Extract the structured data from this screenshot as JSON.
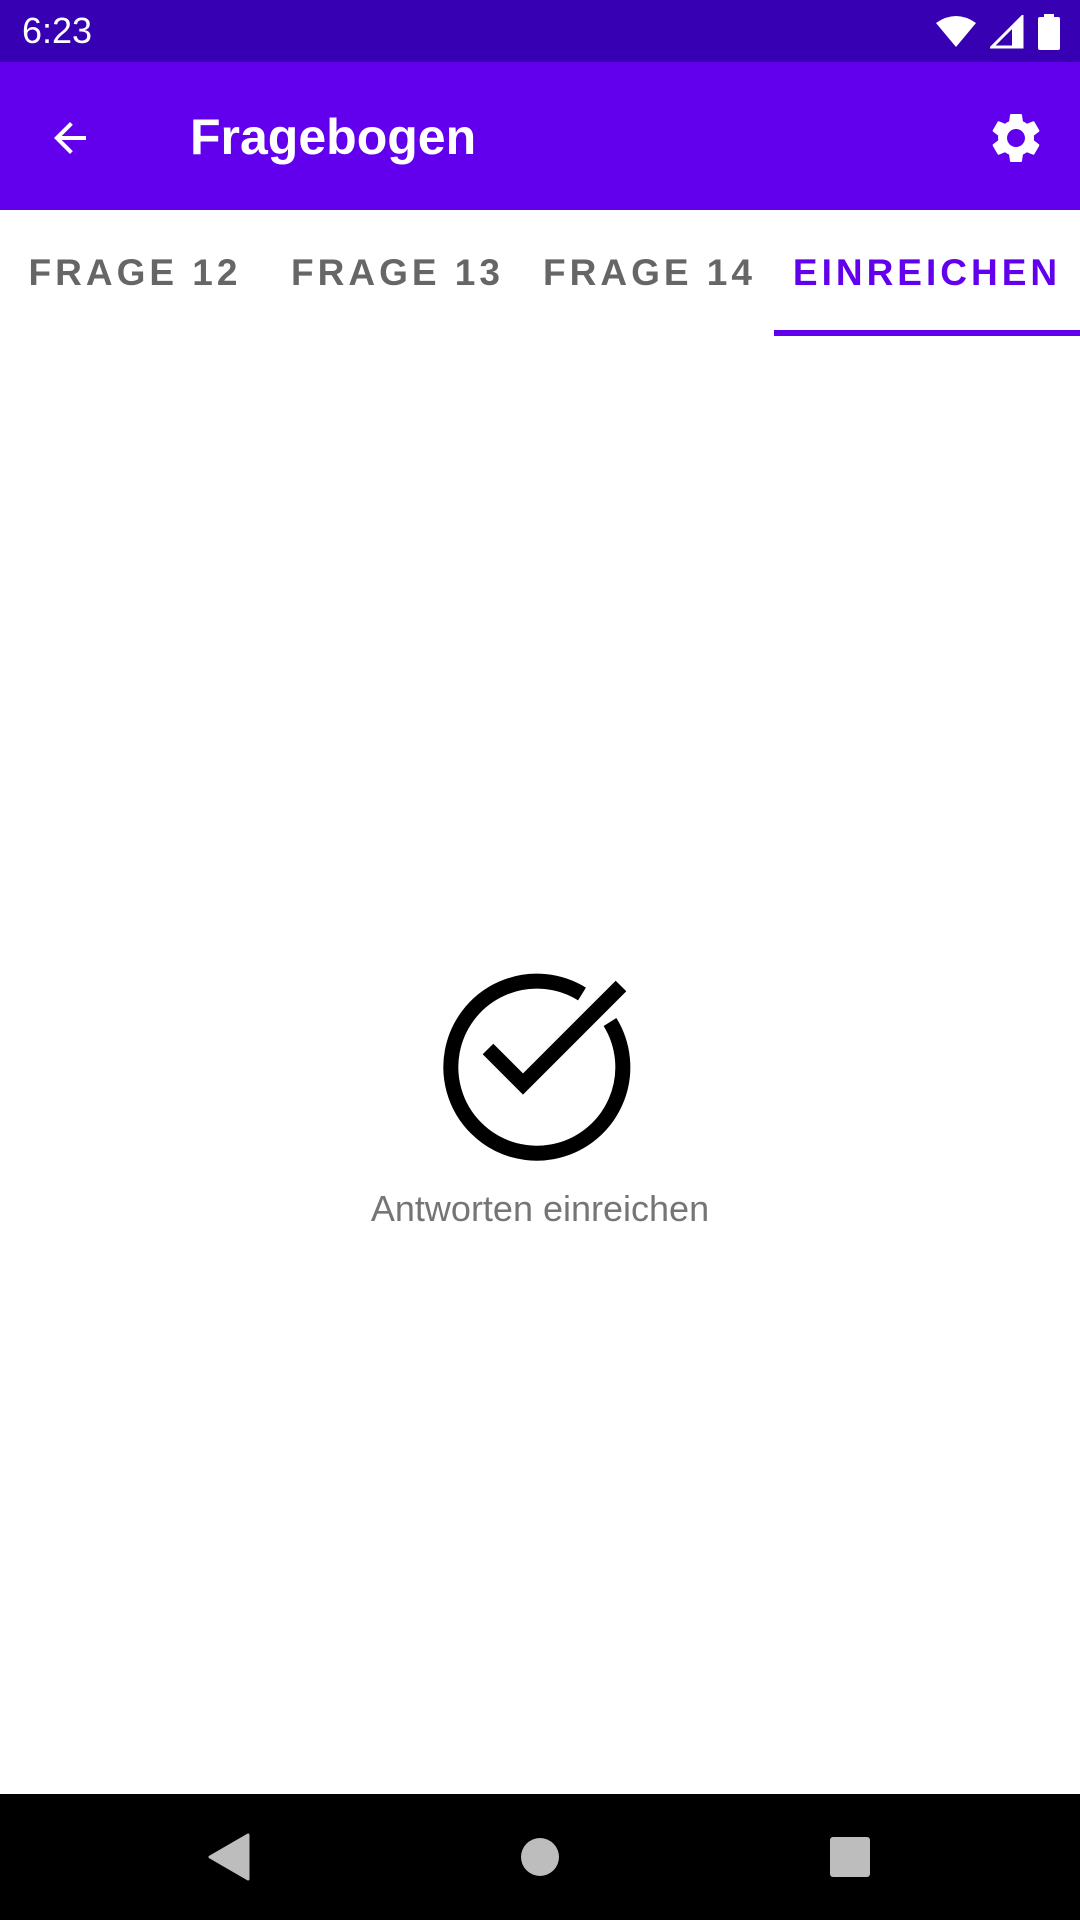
{
  "status_bar": {
    "time": "6:23",
    "icons": [
      "wifi-icon",
      "cellular-signal-icon",
      "battery-icon"
    ]
  },
  "app_bar": {
    "title": "Fragebogen",
    "back_icon": "arrow-back-icon",
    "settings_icon": "gear-icon"
  },
  "tabs": [
    {
      "label": "FRAGE 12",
      "selected": false
    },
    {
      "label": "FRAGE 13",
      "selected": false
    },
    {
      "label": "FRAGE 14",
      "selected": false
    },
    {
      "label": "EINREICHEN",
      "selected": true
    }
  ],
  "main": {
    "submit_icon": "check-circle-icon",
    "submit_label": "Antworten einreichen"
  },
  "nav_bar": {
    "icons": [
      "nav-back-icon",
      "nav-home-icon",
      "nav-recents-icon"
    ]
  },
  "colors": {
    "primary": "#6200ee",
    "primary_dark": "#3700b3",
    "tab_inactive": "#666666",
    "label_gray": "#757575"
  }
}
